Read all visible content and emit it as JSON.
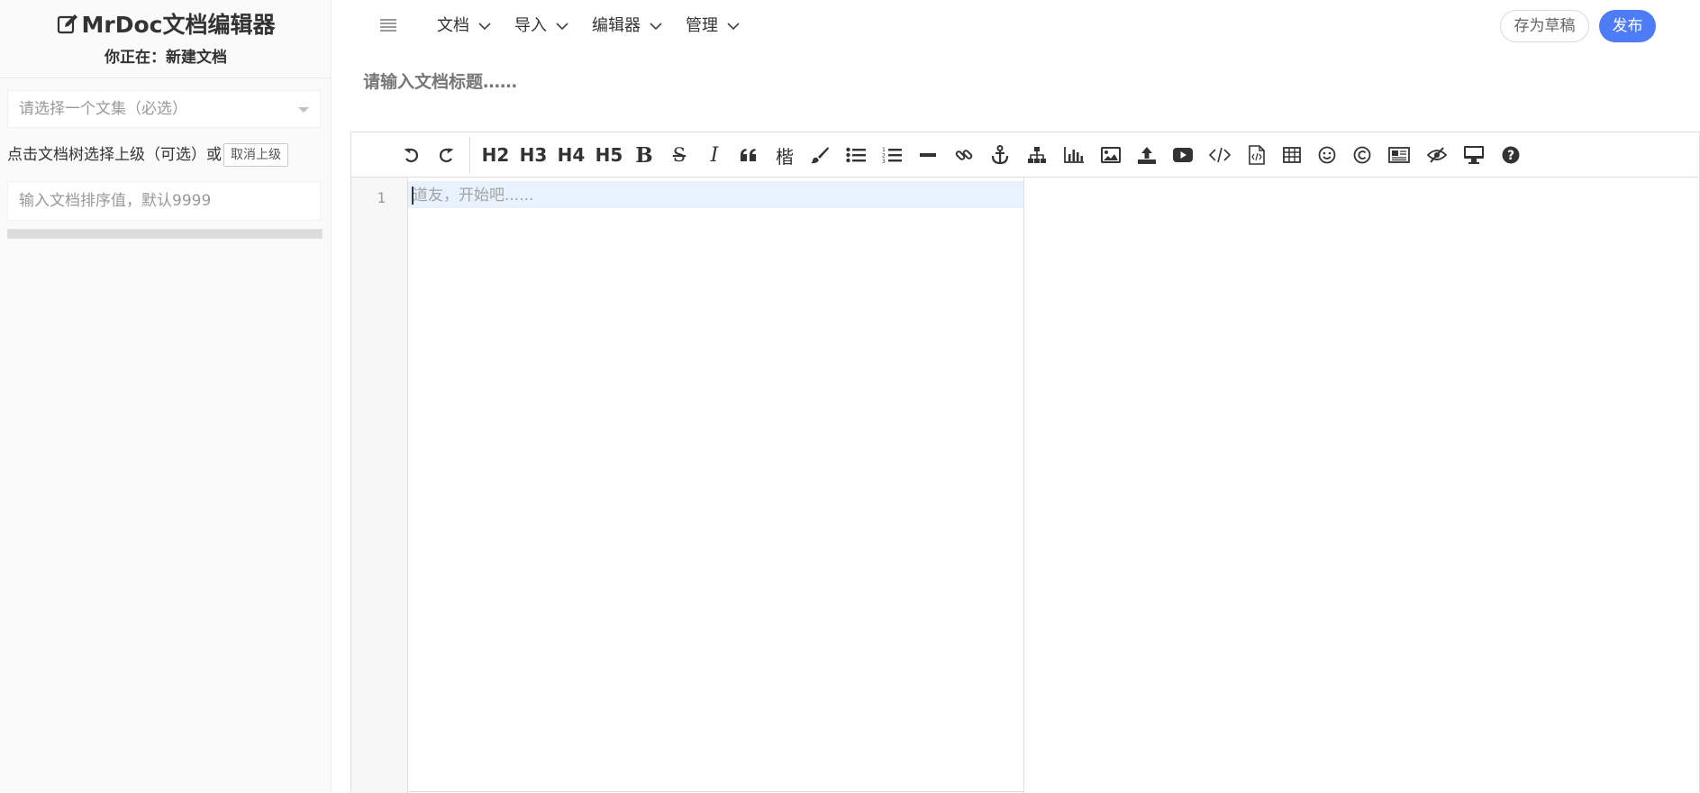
{
  "sidebar": {
    "brand": "MrDoc文档编辑器",
    "current_prefix": "你正在：",
    "current_doc": "新建文档",
    "collection_placeholder": "请选择一个文集（必选）",
    "parent_text": "点击文档树选择上级（可选）或",
    "cancel_parent_label": "取消上级",
    "sort_placeholder": "输入文档排序值，默认9999"
  },
  "nav": {
    "menus": [
      {
        "label": "文档"
      },
      {
        "label": "导入"
      },
      {
        "label": "编辑器"
      },
      {
        "label": "管理"
      }
    ],
    "draft_label": "存为草稿",
    "publish_label": "发布",
    "publish_color": "#4e7cf6"
  },
  "title_placeholder": "请输入文档标题……",
  "toolbar": {
    "headings": [
      "H2",
      "H3",
      "H4",
      "H5"
    ],
    "kai": "楷",
    "icons": [
      "undo-icon",
      "redo-icon",
      "bold-icon",
      "strikethrough-icon",
      "italic-icon",
      "quote-icon",
      "kai-font-icon",
      "paintbrush-icon",
      "unordered-list-icon",
      "ordered-list-icon",
      "horizontal-rule-icon",
      "link-icon",
      "anchor-icon",
      "sitemap-icon",
      "bar-chart-icon",
      "image-icon",
      "upload-icon",
      "video-icon",
      "code-icon",
      "code-file-icon",
      "table-icon",
      "emoji-icon",
      "copyright-icon",
      "newspaper-icon",
      "eye-slash-icon",
      "desktop-icon",
      "help-icon"
    ]
  },
  "editor": {
    "line_number": "1",
    "placeholder": "道友，开始吧......"
  }
}
